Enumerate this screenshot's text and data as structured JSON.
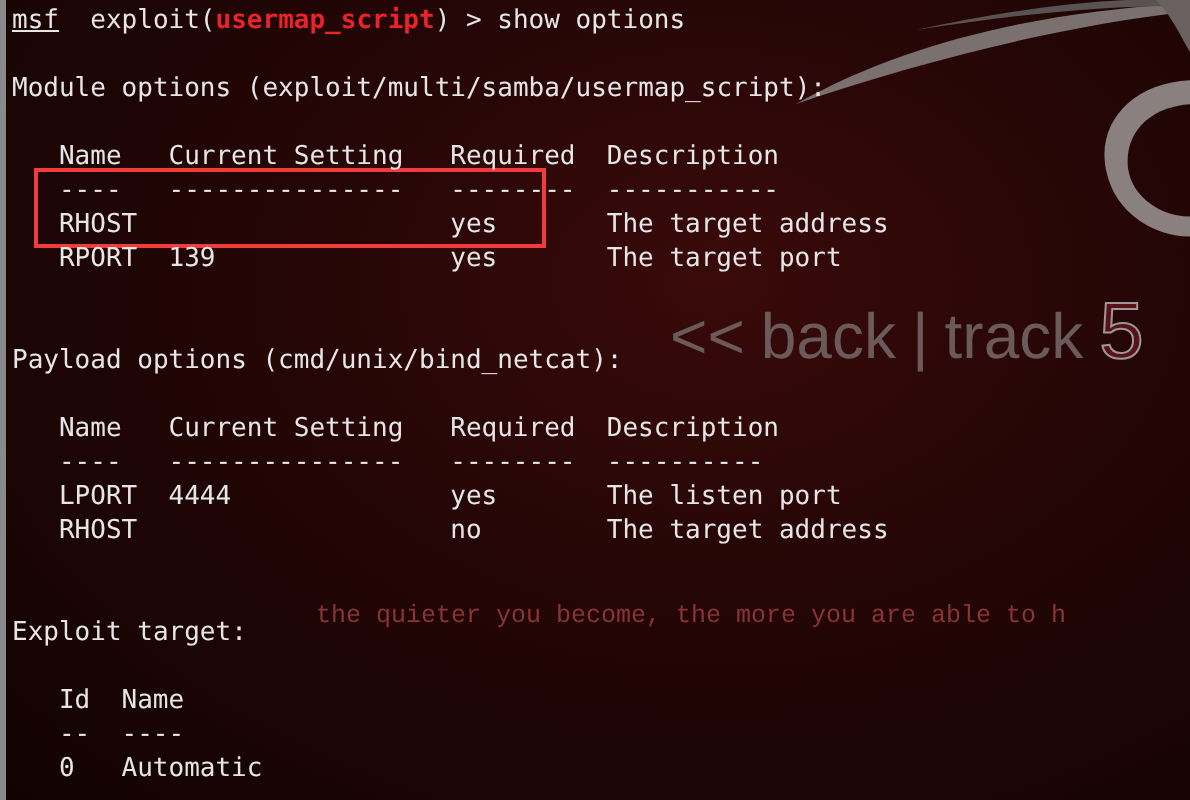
{
  "wallpaper": {
    "logo": [
      "<<",
      "back",
      "|",
      "track",
      "5"
    ],
    "slogan": "the quieter you become, the more you are able to h"
  },
  "prompt": {
    "shell": "msf",
    "command_before": "exploit(",
    "module": "usermap_script",
    "command_after": ") > show options"
  },
  "sections": [
    {
      "title": "Module options (exploit/multi/samba/usermap_script):",
      "kind": "options",
      "columns": [
        "Name",
        "Current Setting",
        "Required",
        "Description"
      ],
      "underline": [
        "----",
        "---------------",
        "--------",
        "-----------"
      ],
      "rows": [
        {
          "cells": [
            "RHOST",
            "",
            "yes",
            "The target address"
          ],
          "highlighted": true
        },
        {
          "cells": [
            "RPORT",
            "139",
            "yes",
            "The target port"
          ],
          "highlighted": false
        }
      ]
    },
    {
      "title": "Payload options (cmd/unix/bind_netcat):",
      "kind": "options",
      "columns": [
        "Name",
        "Current Setting",
        "Required",
        "Description"
      ],
      "underline": [
        "----",
        "---------------",
        "--------",
        "----------"
      ],
      "rows": [
        {
          "cells": [
            "LPORT",
            "4444",
            "yes",
            "The listen port"
          ],
          "highlighted": false
        },
        {
          "cells": [
            "RHOST",
            "",
            "no",
            "The target address"
          ],
          "highlighted": false
        }
      ]
    },
    {
      "title": "Exploit target:",
      "kind": "targets",
      "columns": [
        "Id",
        "Name"
      ],
      "underline": [
        "--",
        "----"
      ],
      "rows": [
        {
          "cells": [
            "0",
            "Automatic"
          ],
          "highlighted": false
        }
      ]
    }
  ]
}
